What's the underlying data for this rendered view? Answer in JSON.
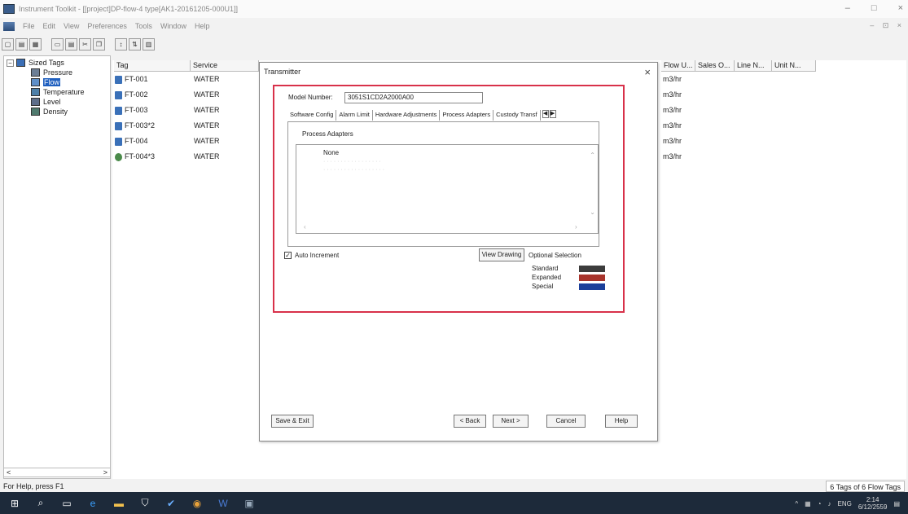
{
  "window": {
    "title": "Instrument Toolkit - [[project]DP-flow-4 type[AK1-20161205-000U1]]",
    "controls": [
      "–",
      "□",
      "×"
    ],
    "mdi_controls": "– ⊡ ×"
  },
  "menu": [
    "File",
    "Edit",
    "View",
    "Preferences",
    "Tools",
    "Window",
    "Help"
  ],
  "tree": {
    "root": "Sized Tags",
    "items": [
      "Pressure",
      "Flow",
      "Temperature",
      "Level",
      "Density"
    ],
    "selected": "Flow",
    "scroll_left": "<",
    "scroll_right": ">"
  },
  "grid": {
    "headers": [
      "Tag",
      "Service",
      "Flow U...",
      "Sales O...",
      "Line N...",
      "Unit N..."
    ],
    "rows": [
      {
        "tag": "FT-001",
        "service": "WATER",
        "flow_units": "m3/hr"
      },
      {
        "tag": "FT-002",
        "service": "WATER",
        "flow_units": "m3/hr"
      },
      {
        "tag": "FT-003",
        "service": "WATER",
        "flow_units": "m3/hr"
      },
      {
        "tag": "FT-003*2",
        "service": "WATER",
        "flow_units": "m3/hr"
      },
      {
        "tag": "FT-004",
        "service": "WATER",
        "flow_units": "m3/hr"
      },
      {
        "tag": "FT-004*3",
        "service": "WATER",
        "flow_units": "m3/hr"
      }
    ]
  },
  "dialog": {
    "title": "Transmitter",
    "close": "×",
    "model_label": "Model Number:",
    "model_value": "3051S1CD2A2000A00",
    "tabs": [
      "Software Config",
      "Alarm Limit",
      "Hardware Adjustments",
      "Process Adapters",
      "Custody Transf"
    ],
    "active_tab": "Process Adapters",
    "tab_prev": "◀",
    "tab_next": "▶",
    "section_label": "Process Adapters",
    "list_items": [
      "None"
    ],
    "auto_increment_label": "Auto Increment",
    "auto_increment_checked": true,
    "view_drawing": "View Drawing",
    "optional_selection": "Optional Selection",
    "legend": [
      {
        "label": "Standard",
        "color": "#3c3c3c"
      },
      {
        "label": "Expanded",
        "color": "#a8342c"
      },
      {
        "label": "Special",
        "color": "#1c3f9a"
      }
    ],
    "buttons": {
      "save_exit": "Save & Exit",
      "back": "< Back",
      "next": "Next >",
      "cancel": "Cancel",
      "help": "Help"
    }
  },
  "status": {
    "help": "For Help, press F1",
    "count": "6 Tags of 6 Flow Tags"
  },
  "taskbar": {
    "language": "ENG",
    "time": "2:14",
    "date": "6/12/2559"
  },
  "colors": {
    "highlight_frame": "#d8314a",
    "selection": "#1f5fbf",
    "taskbar": "#1d2a3a"
  }
}
